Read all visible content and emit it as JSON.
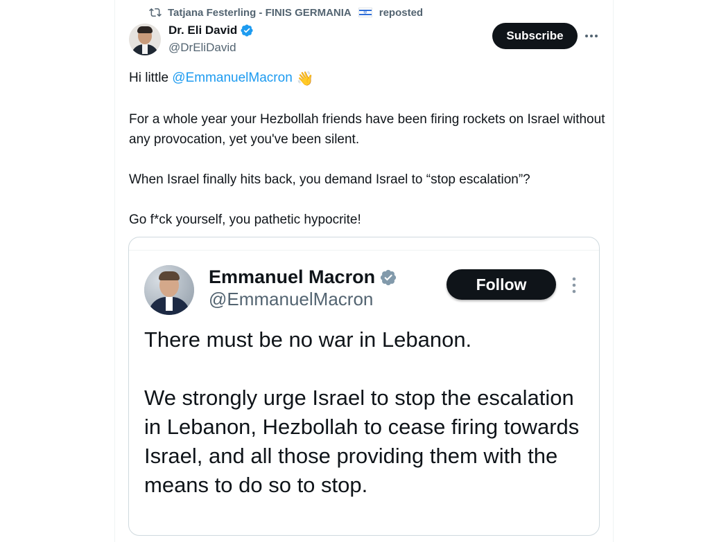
{
  "repost": {
    "reposter_name": "Tatjana Festerling - FINIS GERMANIA",
    "suffix": "reposted",
    "icon": "repost-icon",
    "flag": "israel-flag-emoji"
  },
  "post": {
    "author_name": "Dr. Eli David",
    "author_handle": "@DrEliDavid",
    "verified": true,
    "subscribe_label": "Subscribe",
    "more_icon": "more-icon",
    "greeting_prefix": "Hi little",
    "mention": "@EmmanuelMacron",
    "wave_emoji": "👋",
    "paragraph_2": "For a whole year your Hezbollah friends have been firing rockets on Israel without any provocation, yet you've been silent.",
    "paragraph_3": "When Israel finally hits back, you demand Israel to “stop escalation”?",
    "paragraph_4": "Go f*ck yourself, you pathetic hypocrite!"
  },
  "quoted": {
    "author_name": "Emmanuel Macron",
    "author_handle": "@EmmanuelMacron",
    "verified_color": "grey",
    "follow_label": "Follow",
    "paragraph_1": "There must be no war in Lebanon.",
    "paragraph_2": "We strongly urge Israel to stop the escalation in Lebanon, Hezbollah to cease firing towards Israel, and all those providing them with the means to do so to stop."
  },
  "colors": {
    "text": "#0f1419",
    "secondary": "#536471",
    "link": "#1d9bf0",
    "verified_blue": "#1d9bf0",
    "verified_grey": "#829aab",
    "button_bg": "#0f1419",
    "border": "#cfd9de"
  }
}
